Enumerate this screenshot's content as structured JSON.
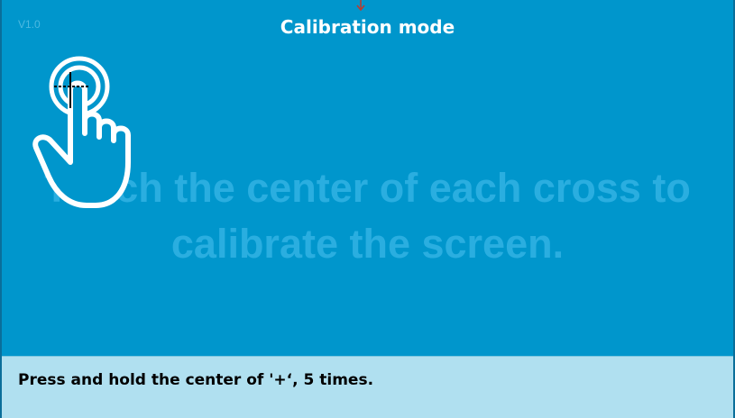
{
  "header": {
    "version": "V1.0",
    "title": "Calibration mode"
  },
  "main": {
    "instruction_line1": "Touch the center of each cross to",
    "instruction_line2": "calibrate the screen."
  },
  "footer": {
    "hint": "Press and hold the center of '+‘, 5 times."
  },
  "icons": {
    "hand": "touch-hand-icon",
    "target": "crosshair-icon",
    "top_marker": "arrow-down-icon"
  },
  "colors": {
    "background": "#0096cc",
    "instruction_text": "#2aaee0",
    "footer_background": "#b0e0f0"
  }
}
